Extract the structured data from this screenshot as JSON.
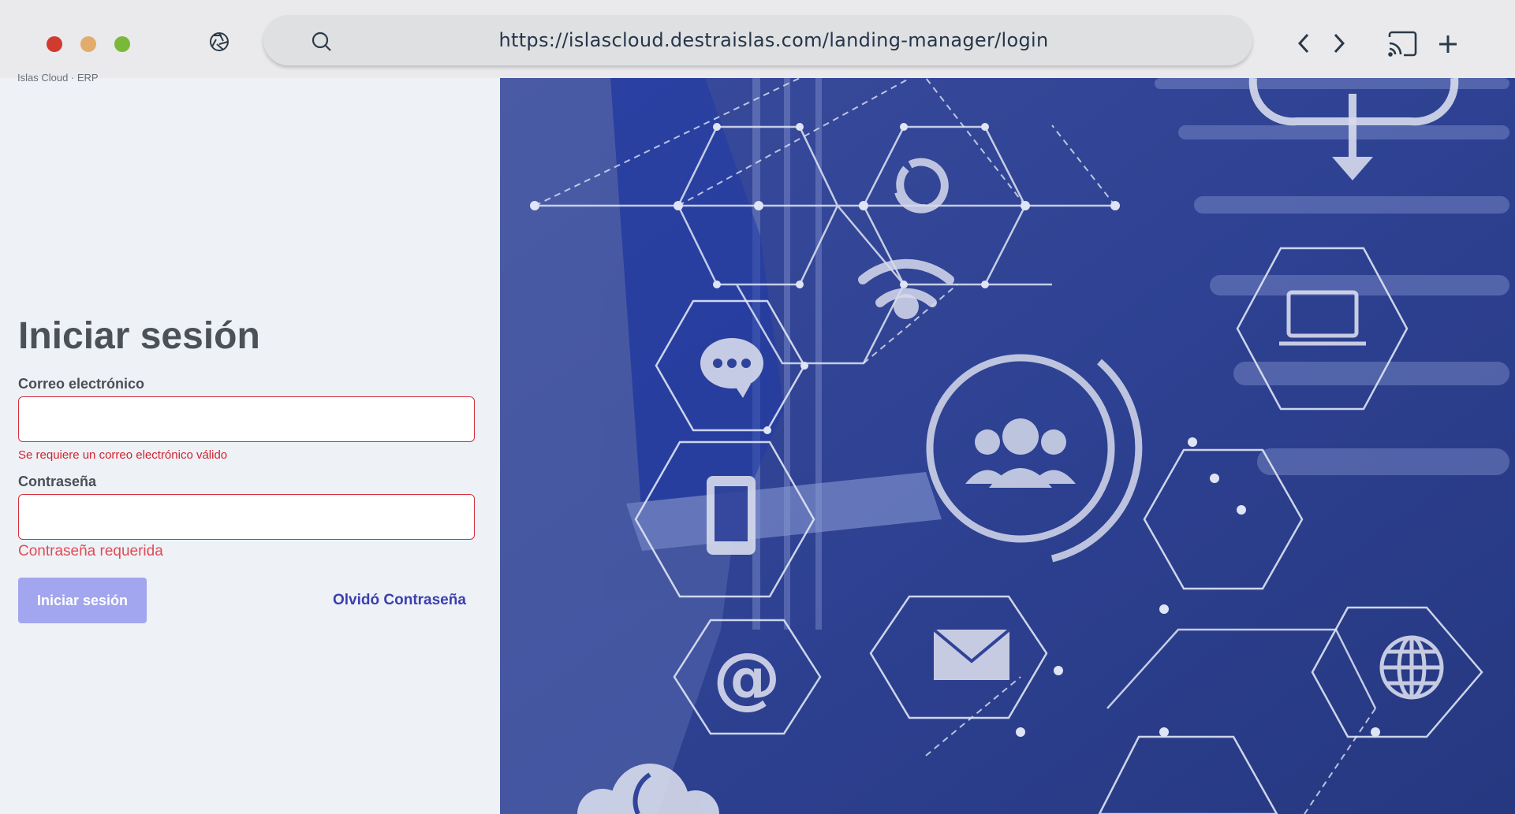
{
  "browser": {
    "url": "https://islascloud.destraislas.com/landing-manager/login",
    "icons": [
      "aperture-icon",
      "search-icon",
      "chevron-left-icon",
      "chevron-right-icon",
      "cast-icon",
      "plus-icon"
    ]
  },
  "left": {
    "top_crumb": "Islas Cloud · ERP",
    "title": "Iniciar sesión",
    "email_label": "Correo electrónico",
    "email_value": "",
    "email_error": "Se requiere un correo electrónico válido",
    "password_label": "Contraseña",
    "password_value": "",
    "password_error": "Contraseña requerida",
    "login_button": "Iniciar sesión",
    "forgot_link": "Olvidó Contraseña"
  },
  "hero": {
    "overlay_color": "#2c3f96",
    "icons": [
      "refresh-icon",
      "download-icon",
      "wifi-icon",
      "chat-icon",
      "users-icon",
      "laptop-icon",
      "phone-icon",
      "email-at-icon",
      "envelope-icon",
      "globe-icon",
      "cloud-icon"
    ]
  },
  "colors": {
    "error": "#d6303c",
    "button": "#a2a6ee",
    "link": "#3b3fae",
    "title": "#4c5157"
  }
}
